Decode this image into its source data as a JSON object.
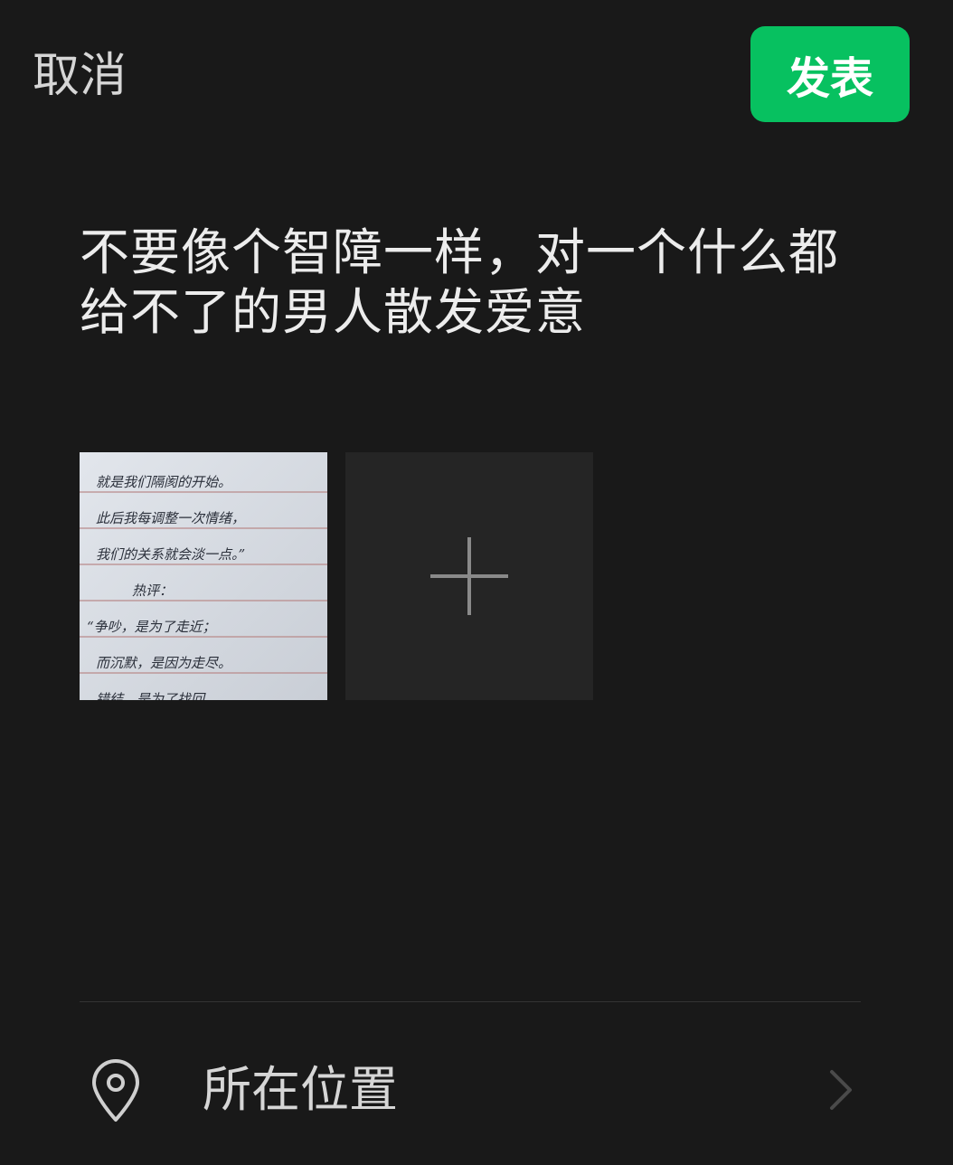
{
  "header": {
    "cancel_label": "取消",
    "publish_label": "发表"
  },
  "post": {
    "text": "不要像个智障一样，对一个什么都给不了的男人散发爱意"
  },
  "photo": {
    "handwriting_lines": [
      "就是我们隔阂的开始。",
      "此后我每调整一次情绪，",
      "我们的关系就会淡一点。”",
      "热评：",
      "“争吵，是为了走近；",
      "而沉默，是因为走尽。",
      "错结，是为了找回"
    ]
  },
  "location": {
    "label": "所在位置"
  },
  "colors": {
    "background": "#191919",
    "accent": "#07c160",
    "tile": "#252525"
  },
  "icons": [
    "location-pin-icon",
    "plus-icon",
    "chevron-right-icon"
  ]
}
